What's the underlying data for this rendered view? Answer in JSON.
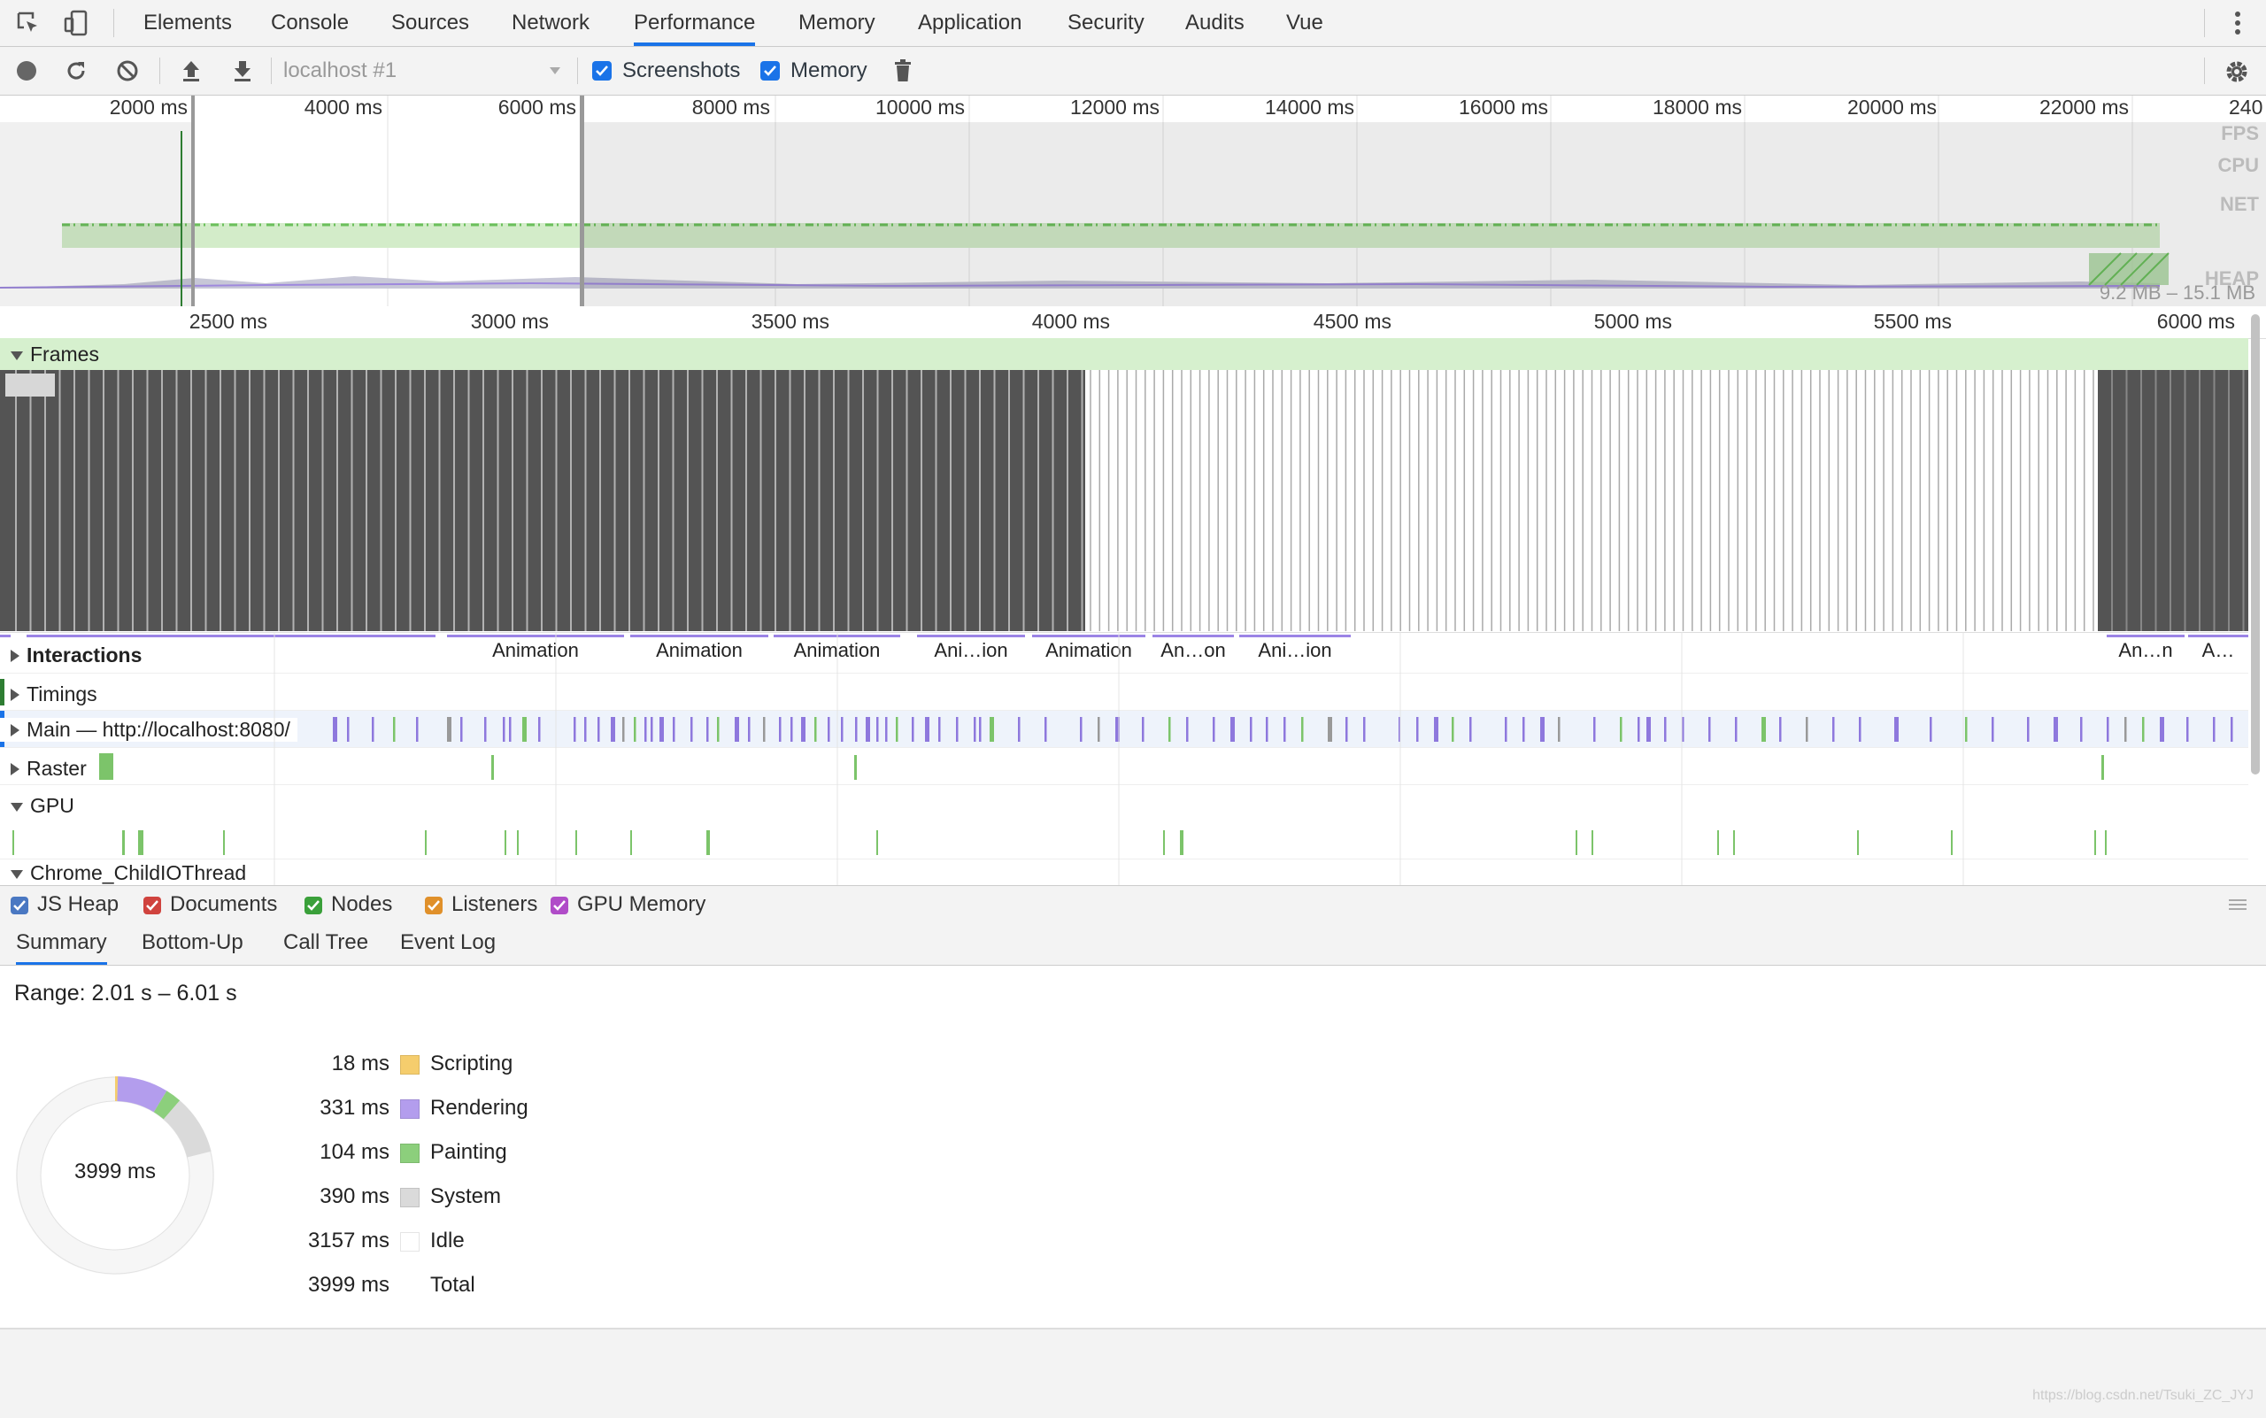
{
  "tabs": [
    "Elements",
    "Console",
    "Sources",
    "Network",
    "Performance",
    "Memory",
    "Application",
    "Security",
    "Audits",
    "Vue"
  ],
  "active_tab": "Performance",
  "toolbar": {
    "target": "localhost #1",
    "screenshots_label": "Screenshots",
    "memory_label": "Memory",
    "screenshots_checked": true,
    "memory_checked": true
  },
  "overview": {
    "ticks": [
      "2000 ms",
      "4000 ms",
      "6000 ms",
      "8000 ms",
      "10000 ms",
      "12000 ms",
      "14000 ms",
      "16000 ms",
      "18000 ms",
      "20000 ms",
      "22000 ms",
      "240"
    ],
    "labels": {
      "fps": "FPS",
      "cpu": "CPU",
      "net": "NET",
      "heap": "HEAP"
    },
    "heap_range": "9.2 MB – 15.1 MB"
  },
  "ruler": [
    "2500 ms",
    "3000 ms",
    "3500 ms",
    "4000 ms",
    "4500 ms",
    "5000 ms",
    "5500 ms",
    "6000 ms"
  ],
  "tracks": {
    "frames": "Frames",
    "interactions": "Interactions",
    "timings": "Timings",
    "main": "Main — http://localhost:8080/",
    "raster": "Raster",
    "gpu": "GPU",
    "child_io": "Chrome_ChildIOThread"
  },
  "interactions": [
    "Animation",
    "Animation",
    "Animation",
    "Ani…ion",
    "Animation",
    "An…on",
    "Ani…ion",
    "An…n",
    "A…"
  ],
  "memory_legend": [
    {
      "label": "JS Heap",
      "color": "#4a78c2"
    },
    {
      "label": "Documents",
      "color": "#d0433e"
    },
    {
      "label": "Nodes",
      "color": "#3aa03a"
    },
    {
      "label": "Listeners",
      "color": "#e0902a"
    },
    {
      "label": "GPU Memory",
      "color": "#b04cc8"
    }
  ],
  "bottom_tabs": [
    "Summary",
    "Bottom-Up",
    "Call Tree",
    "Event Log"
  ],
  "summary": {
    "range": "Range: 2.01 s – 6.01 s",
    "total_center": "3999 ms",
    "rows": [
      {
        "value": "18 ms",
        "label": "Scripting",
        "color": "#f5cd6d"
      },
      {
        "value": "331 ms",
        "label": "Rendering",
        "color": "#b39ded"
      },
      {
        "value": "104 ms",
        "label": "Painting",
        "color": "#8ccf7c"
      },
      {
        "value": "390 ms",
        "label": "System",
        "color": "#dadada"
      },
      {
        "value": "3157 ms",
        "label": "Idle",
        "color": "#ffffff"
      },
      {
        "value": "3999 ms",
        "label": "Total",
        "color": ""
      }
    ]
  },
  "watermark": "https://blog.csdn.net/Tsuki_ZC_JYJ"
}
